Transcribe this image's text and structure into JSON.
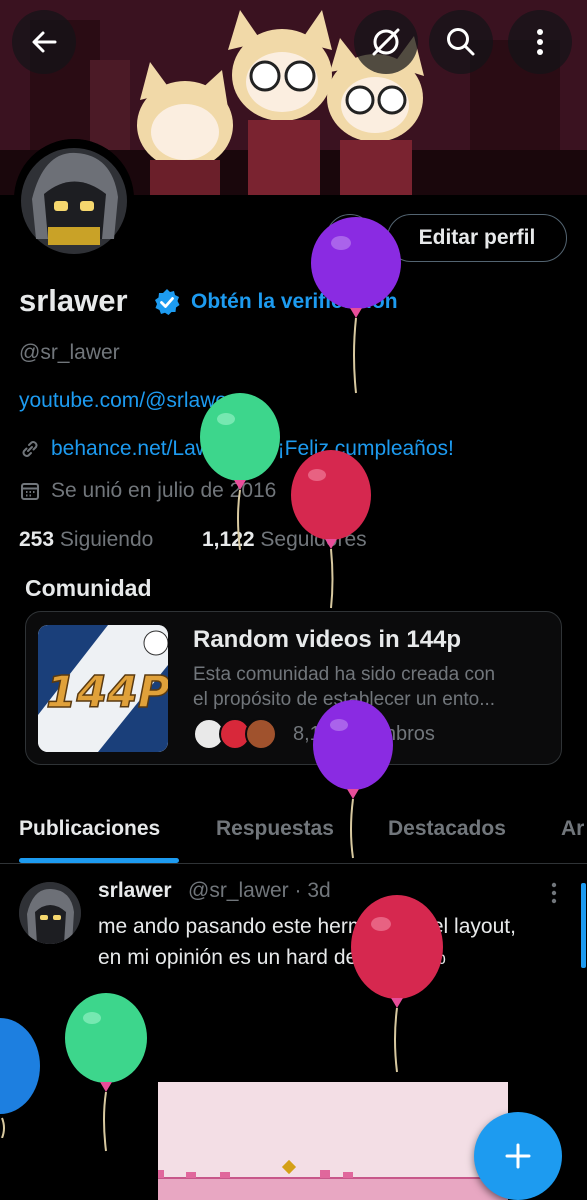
{
  "profile": {
    "name": "srlawer",
    "verify_cta": "Obtén la verificación",
    "handle": "@sr_lawer",
    "bio_link": "youtube.com/@srlawer",
    "website": "behance.net/Lawer",
    "birthday": "¡Feliz cumpleaños!",
    "joined": "Se unió en julio de 2016",
    "following_count": "253",
    "following_label": "Siguiendo",
    "followers_count": "1,122",
    "followers_label": "Seguidores",
    "edit_label": "Editar perfil"
  },
  "community": {
    "section_title": "Comunidad",
    "name": "Random videos in 144p",
    "description_line1": "Esta comunidad ha sido creada con",
    "description_line2": "el propósito de establecer un ento...",
    "members": "8,115 miembros",
    "thumb_text": "144P"
  },
  "tabs": [
    {
      "label": "Publicaciones",
      "active": true
    },
    {
      "label": "Respuestas",
      "active": false
    },
    {
      "label": "Destacados",
      "active": false
    },
    {
      "label": "Ar",
      "active": false
    }
  ],
  "post": {
    "author": "srlawer",
    "meta": "@sr_lawer · 3d",
    "text": "me ando pasando este hermoso nivel layout, en mi opinión es un hard demon 50%"
  },
  "colors": {
    "accent": "#1d9bf0",
    "balloon_purple": "#8a2be2",
    "balloon_green": "#3dd68c",
    "balloon_red": "#d6284f",
    "balloon_blue": "#1d7fe0"
  },
  "icons": [
    "back-arrow-icon",
    "hide-icon",
    "search-icon",
    "more-vertical-icon",
    "verified-badge-icon",
    "link-icon",
    "balloon-icon",
    "calendar-icon",
    "chevron-right-icon",
    "plus-icon"
  ]
}
